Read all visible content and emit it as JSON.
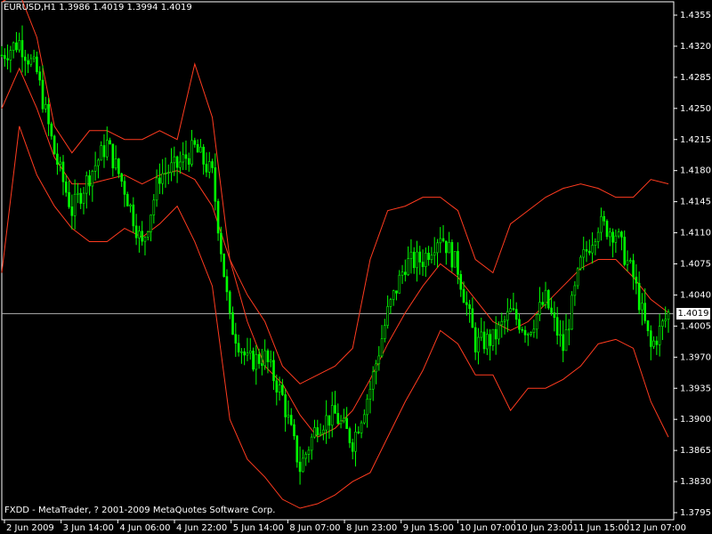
{
  "header": {
    "symbol": "EURUSD,H1",
    "ohlc": "1.3986 1.4019 1.3994 1.4019"
  },
  "footer": {
    "copyright": "FXDD - MetaTrader, ? 2001-2009 MetaQuotes Software Corp."
  },
  "current_price": "1.4019",
  "colors": {
    "background": "#000000",
    "candle": "#00ff00",
    "bands": "#ff3b1f",
    "axis": "#ffffff",
    "price_line": "#b0b0b0"
  },
  "chart_data": {
    "type": "line",
    "title": "",
    "y_ticks": [
      "1.4355",
      "1.4320",
      "1.4285",
      "1.4250",
      "1.4215",
      "1.4180",
      "1.4145",
      "1.4110",
      "1.4075",
      "1.4040",
      "1.4005",
      "1.3970",
      "1.3935",
      "1.3900",
      "1.3865",
      "1.3830",
      "1.3795"
    ],
    "x_ticks": [
      "2 Jun 2009",
      "3 Jun 14:00",
      "4 Jun 06:00",
      "4 Jun 22:00",
      "5 Jun 14:00",
      "8 Jun 07:00",
      "8 Jun 23:00",
      "9 Jun 15:00",
      "10 Jun 07:00",
      "10 Jun 23:00",
      "11 Jun 15:00",
      "12 Jun 07:00"
    ],
    "ylim": [
      1.3795,
      1.4355
    ],
    "grid": false,
    "series": [
      {
        "kind": "price",
        "x": [
          0,
          6,
          12,
          18,
          24,
          30,
          36,
          42,
          48,
          54,
          60,
          66,
          72,
          78,
          84,
          90,
          96,
          102,
          108,
          114,
          120,
          126,
          132,
          138,
          144,
          150,
          156,
          162,
          168,
          174,
          180,
          186,
          192,
          198,
          204,
          210,
          216,
          222,
          228
        ],
        "values": [
          1.431,
          1.4325,
          1.429,
          1.42,
          1.4135,
          1.4175,
          1.421,
          1.416,
          1.4095,
          1.4175,
          1.4185,
          1.4205,
          1.4175,
          1.401,
          1.3965,
          1.397,
          1.3925,
          1.3845,
          1.3895,
          1.3905,
          1.3875,
          1.3935,
          1.402,
          1.4075,
          1.408,
          1.411,
          1.407,
          1.3985,
          1.399,
          1.402,
          1.4,
          1.4035,
          1.398,
          1.4075,
          1.412,
          1.411,
          1.406,
          1.398,
          1.4019
        ]
      },
      {
        "kind": "upper-band",
        "x": [
          0,
          6,
          12,
          18,
          24,
          30,
          36,
          42,
          48,
          54,
          60,
          66,
          72,
          78,
          84,
          90,
          96,
          102,
          108,
          114,
          120,
          126,
          132,
          138,
          144,
          150,
          156,
          162,
          168,
          174,
          180,
          186,
          192,
          198,
          204,
          210,
          216,
          222,
          228
        ],
        "values": [
          1.437,
          1.438,
          1.433,
          1.423,
          1.42,
          1.4225,
          1.4225,
          1.4215,
          1.4215,
          1.4225,
          1.4215,
          1.43,
          1.424,
          1.408,
          1.404,
          1.401,
          1.396,
          1.394,
          1.395,
          1.396,
          1.398,
          1.408,
          1.4135,
          1.414,
          1.415,
          1.415,
          1.4135,
          1.408,
          1.4065,
          1.412,
          1.4135,
          1.415,
          1.416,
          1.4165,
          1.416,
          1.415,
          1.415,
          1.417,
          1.4165
        ]
      },
      {
        "kind": "middle-band",
        "x": [
          0,
          6,
          12,
          18,
          24,
          30,
          36,
          42,
          48,
          54,
          60,
          66,
          72,
          78,
          84,
          90,
          96,
          102,
          108,
          114,
          120,
          126,
          132,
          138,
          144,
          150,
          156,
          162,
          168,
          174,
          180,
          186,
          192,
          198,
          204,
          210,
          216,
          222,
          228
        ],
        "values": [
          1.425,
          1.4295,
          1.425,
          1.4195,
          1.4165,
          1.4165,
          1.417,
          1.4175,
          1.4165,
          1.4175,
          1.418,
          1.417,
          1.414,
          1.408,
          1.401,
          1.396,
          1.394,
          1.3905,
          1.388,
          1.389,
          1.391,
          1.3945,
          1.3985,
          1.402,
          1.405,
          1.4075,
          1.406,
          1.4035,
          1.401,
          1.4,
          1.401,
          1.403,
          1.405,
          1.407,
          1.408,
          1.408,
          1.406,
          1.4035,
          1.402
        ]
      },
      {
        "kind": "lower-band",
        "x": [
          0,
          6,
          12,
          18,
          24,
          30,
          36,
          42,
          48,
          54,
          60,
          66,
          72,
          78,
          84,
          90,
          96,
          102,
          108,
          114,
          120,
          126,
          132,
          138,
          144,
          150,
          156,
          162,
          168,
          174,
          180,
          186,
          192,
          198,
          204,
          210,
          216,
          222,
          228
        ],
        "values": [
          1.4065,
          1.423,
          1.4175,
          1.414,
          1.4115,
          1.41,
          1.41,
          1.4115,
          1.4105,
          1.412,
          1.414,
          1.41,
          1.405,
          1.39,
          1.3855,
          1.3835,
          1.381,
          1.38,
          1.3805,
          1.3815,
          1.383,
          1.384,
          1.388,
          1.392,
          1.3955,
          1.4,
          1.3985,
          1.395,
          1.395,
          1.391,
          1.3935,
          1.3935,
          1.3945,
          1.396,
          1.3985,
          1.399,
          1.398,
          1.392,
          1.388
        ]
      }
    ]
  }
}
